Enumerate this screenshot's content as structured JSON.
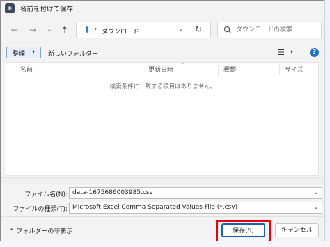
{
  "window": {
    "title": "名前を付けて保存"
  },
  "nav": {
    "back": "←",
    "forward": "→",
    "dropdown": "⌄",
    "up": "↑",
    "address_sep": "›",
    "address_location": "ダウンロード",
    "address_chevron": "⌄",
    "refresh": "↻",
    "search_placeholder": "ダウンロードの検索"
  },
  "toolbar": {
    "organize_label": "整理",
    "organize_caret": "▾",
    "new_folder_label": "新しいフォルダー",
    "view_icon": "☰",
    "view_caret": "▾",
    "help": "?"
  },
  "filelist": {
    "columns": [
      "名前",
      "更新日時",
      "種類",
      "サイズ"
    ],
    "sort_arrow": "⌄",
    "empty_message": "検索条件に一致する項目はありません。"
  },
  "form": {
    "filename_label": "ファイル名(N):",
    "filename_value": "data-1675686003985.csv",
    "filetype_label": "ファイルの種類(T):",
    "filetype_value": "Microsoft Excel Comma Separated Values File (*.csv)",
    "chevron": "⌄"
  },
  "footer": {
    "hide_folders_caret": "⌃",
    "hide_folders_label": "フォルダーの非表示",
    "save_label": "保存(S)",
    "cancel_label": "キャンセル"
  },
  "colors": {
    "accent": "#1a5fb4",
    "highlight_outline": "#e8000b",
    "organize_bg": "#e6effa"
  }
}
